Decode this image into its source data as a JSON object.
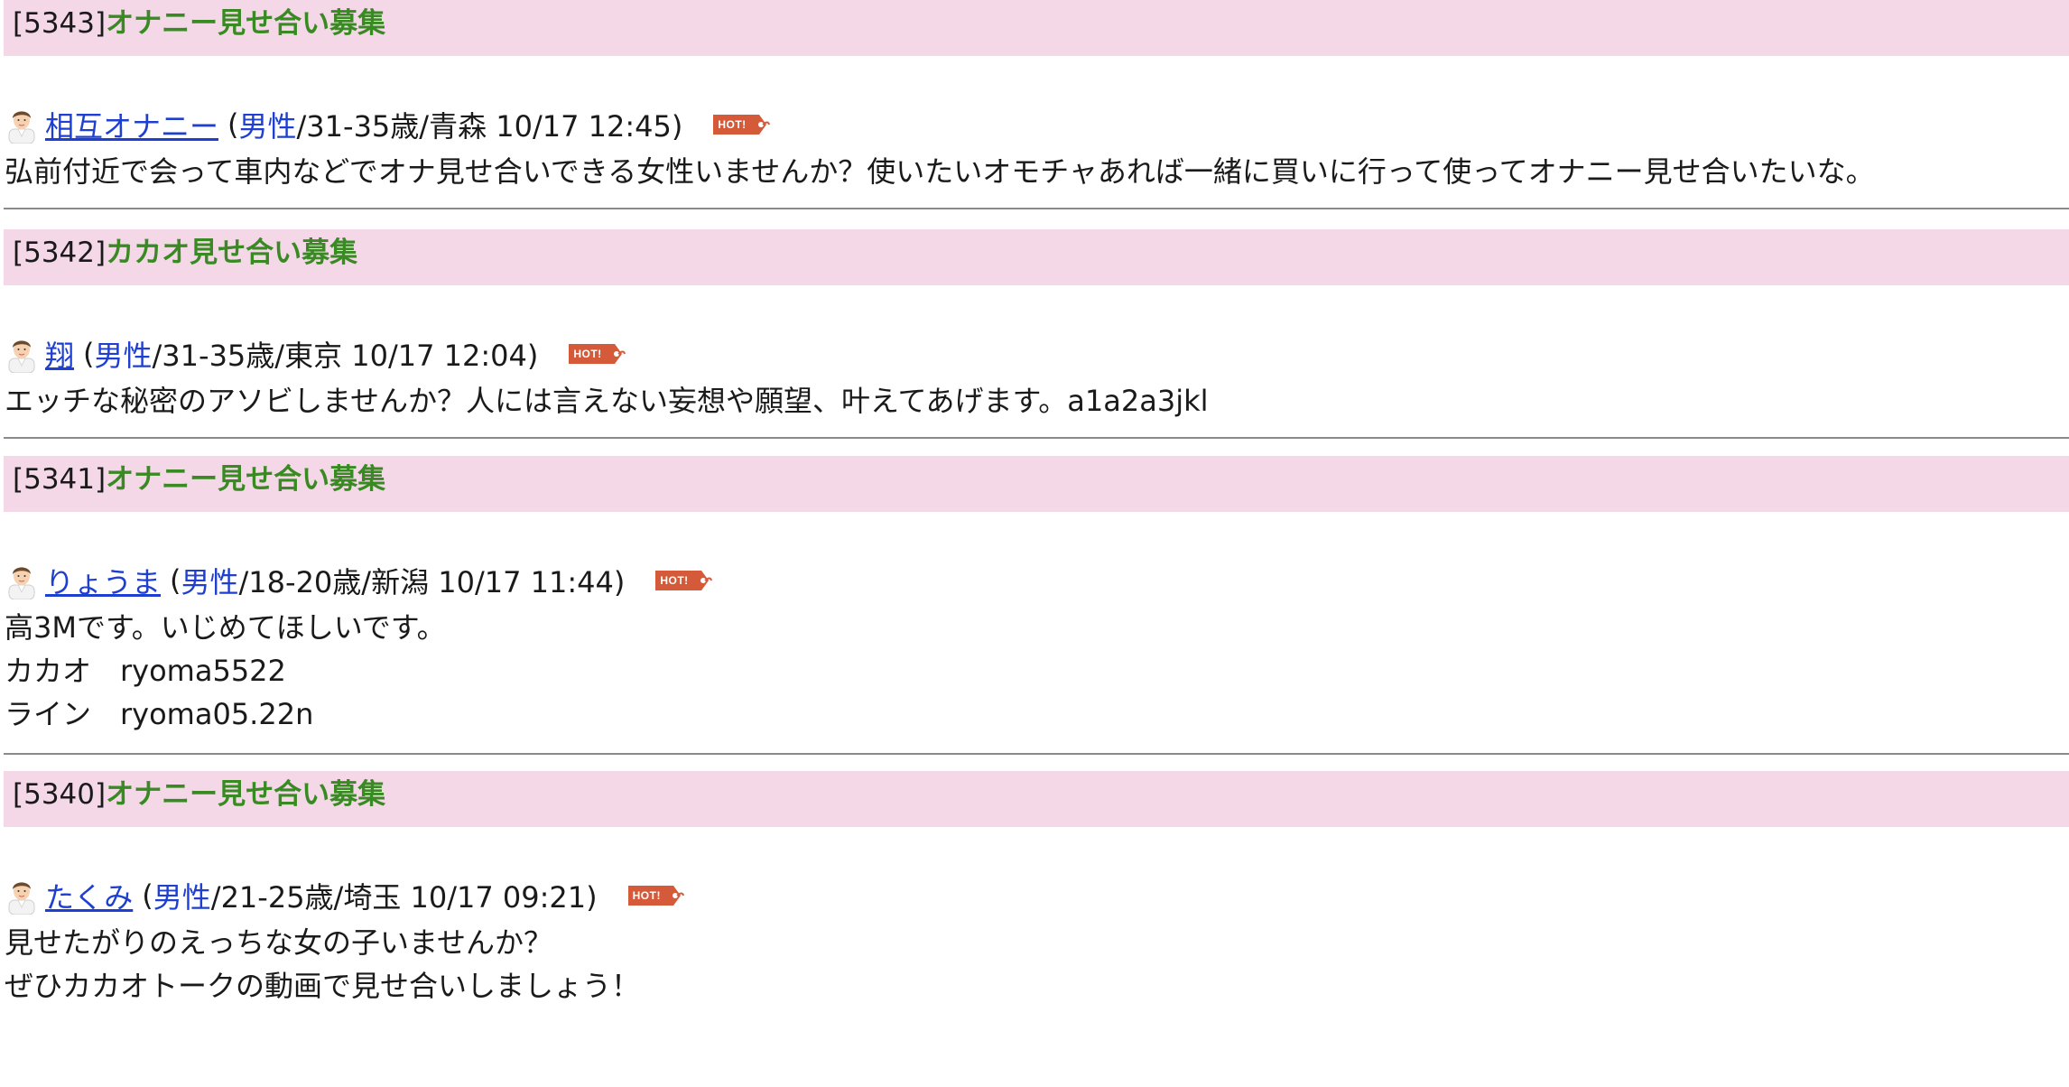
{
  "posts": [
    {
      "number": "[5343]",
      "title": "オナニー見せ合い募集",
      "username": "相互オナニー",
      "paren_open": "(",
      "gender": "男性",
      "details": "/31-35歳/青森 10/17 12:45)",
      "badge": "HOT!",
      "body": [
        "弘前付近で会って車内などでオナ見せ合いできる女性いませんか？使いたいオモチャあれば一緒に買いに行って使ってオナニー見せ合いたいな。"
      ]
    },
    {
      "number": "[5342]",
      "title": "カカオ見せ合い募集",
      "username": "翔",
      "paren_open": "(",
      "gender": "男性",
      "details": "/31-35歳/東京 10/17 12:04)",
      "badge": "HOT!",
      "body": [
        "エッチな秘密のアソビしませんか？人には言えない妄想や願望、叶えてあげます。a1a2a3jkl"
      ]
    },
    {
      "number": "[5341]",
      "title": "オナニー見せ合い募集",
      "username": "りょうま",
      "paren_open": "(",
      "gender": "男性",
      "details": "/18-20歳/新潟 10/17 11:44)",
      "badge": "HOT!",
      "body": [
        "高3Mです。いじめてほしいです。",
        "カカオ　ryoma5522",
        "ライン　ryoma05.22n"
      ]
    },
    {
      "number": "[5340]",
      "title": "オナニー見せ合い募集",
      "username": "たくみ",
      "paren_open": "(",
      "gender": "男性",
      "details": "/21-25歳/埼玉 10/17 09:21)",
      "badge": "HOT!",
      "body": [
        "見せたがりのえっちな女の子いませんか？",
        "ぜひカカオトークの動画で見せ合いしましょう！"
      ]
    }
  ],
  "colors": {
    "header_bg": "#f4d8e8",
    "title": "#3a8a24",
    "link": "#1f3fd0",
    "badge": "#d55a3a"
  },
  "icons": {
    "avatar": "male-user-avatar-icon",
    "badge": "hot-tag-icon"
  }
}
